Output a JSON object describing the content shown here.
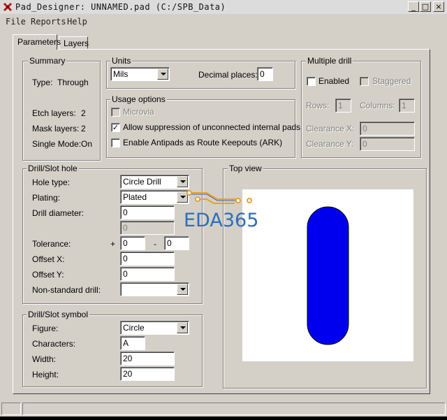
{
  "window": {
    "title": "Pad_Designer: UNNAMED.pad (C:/SPB_Data)"
  },
  "menu": [
    "File",
    "Reports",
    "Help"
  ],
  "tabs": [
    "Parameters",
    "Layers"
  ],
  "summary": {
    "legend": "Summary",
    "type_label": "Type:",
    "type_value": "Through",
    "etch_label": "Etch layers:",
    "etch_value": "2",
    "mask_label": "Mask layers:",
    "mask_value": "2",
    "single_label": "Single Mode:",
    "single_value": "On"
  },
  "units": {
    "legend": "Units",
    "value": "Mils",
    "decimal_label": "Decimal places:",
    "decimal_value": "0"
  },
  "usage": {
    "legend": "Usage options",
    "microvia": "Microvia",
    "allow": "Allow suppression of unconnected internal pads",
    "antipads": "Enable Antipads as Route Keepouts (ARK)"
  },
  "multi": {
    "legend": "Multiple drill",
    "enabled": "Enabled",
    "staggered": "Staggered",
    "rows_label": "Rows:",
    "rows_value": "1",
    "cols_label": "Columns:",
    "cols_value": "1",
    "cx_label": "Clearance X:",
    "cx_value": "0",
    "cy_label": "Clearance Y:",
    "cy_value": "0"
  },
  "drill": {
    "legend": "Drill/Slot hole",
    "hole_type_label": "Hole type:",
    "hole_type_value": "Circle Drill",
    "plating_label": "Plating:",
    "plating_value": "Plated",
    "diameter_label": "Drill diameter:",
    "diameter_value": "0",
    "diameter2_value": "0",
    "tol_label": "Tolerance:",
    "tol_plus": "+",
    "tol_plus_value": "0",
    "tol_minus": "-",
    "tol_minus_value": "0",
    "offx_label": "Offset X:",
    "offx_value": "0",
    "offy_label": "Offset Y:",
    "offy_value": "0",
    "nonstd_label": "Non-standard drill:",
    "nonstd_value": ""
  },
  "symbol": {
    "legend": "Drill/Slot symbol",
    "figure_label": "Figure:",
    "figure_value": "Circle",
    "chars_label": "Characters:",
    "chars_value": "A",
    "width_label": "Width:",
    "width_value": "20",
    "height_label": "Height:",
    "height_value": "20"
  },
  "topview": {
    "legend": "Top view"
  },
  "watermark": {
    "text": "EDA365"
  },
  "colors": {
    "pad_fill": "#0000ee",
    "watermark": "#2f6eb8",
    "trace": "#e8a030"
  }
}
